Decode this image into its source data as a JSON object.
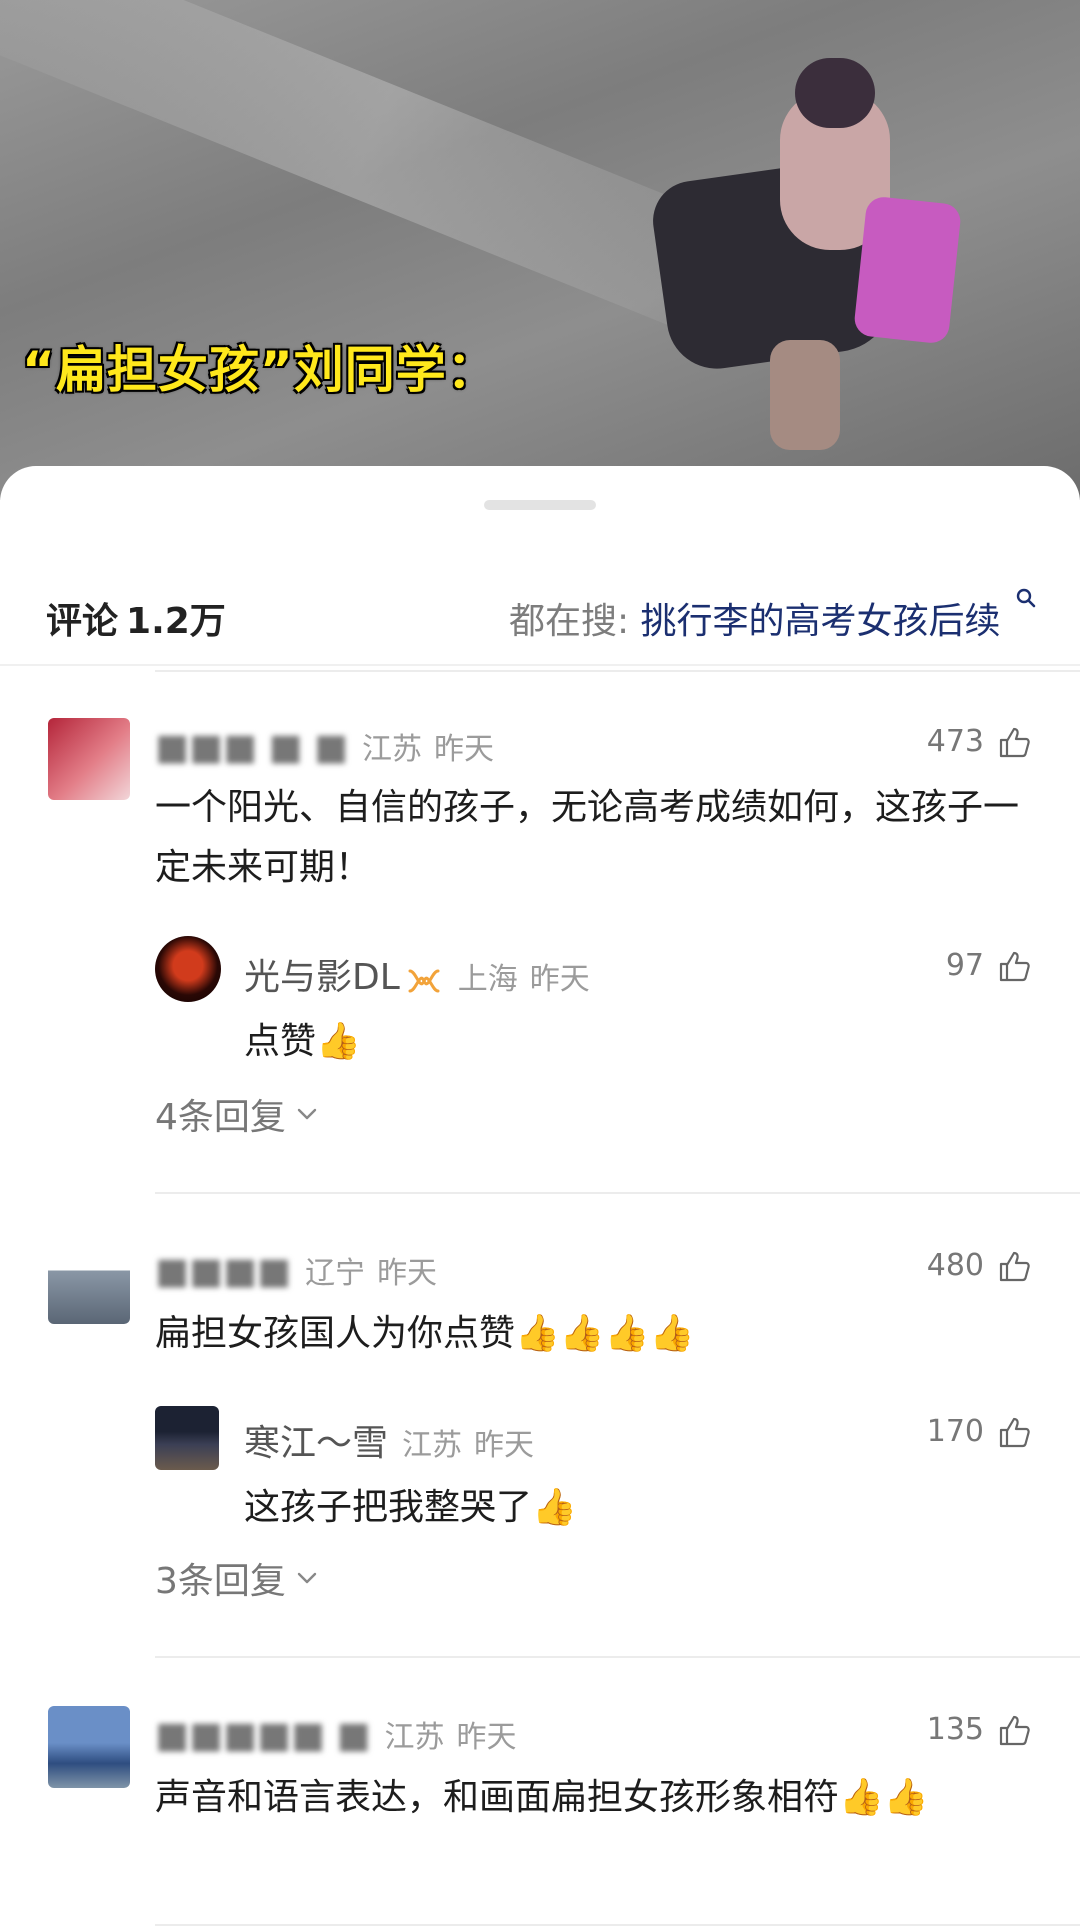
{
  "video": {
    "caption": "“扁担女孩”刘同学："
  },
  "header": {
    "comments_label": "评论",
    "comments_count": "1.2万",
    "search_prefix": "都在搜:",
    "search_keyword": "挑行李的高考女孩后续"
  },
  "comments": [
    {
      "name": "",
      "location": "江苏",
      "time": "昨天",
      "likes": "473",
      "text": "一个阳光、自信的孩子，无论高考成绩如何，这孩子一定未来可期！",
      "reply": {
        "name": "光与影DL",
        "location": "上海",
        "time": "昨天",
        "likes": "97",
        "text": "点赞👍"
      },
      "more_replies": "4条回复"
    },
    {
      "name": "",
      "location": "辽宁",
      "time": "昨天",
      "likes": "480",
      "text": "扁担女孩国人为你点赞👍👍👍👍",
      "reply": {
        "name": "寒江～雪",
        "location": "江苏",
        "time": "昨天",
        "likes": "170",
        "text": "这孩子把我整哭了👍"
      },
      "more_replies": "3条回复"
    },
    {
      "name": "",
      "location": "江苏",
      "time": "昨天",
      "likes": "135",
      "text": "声音和语言表达，和画面扁担女孩形象相符👍👍"
    }
  ],
  "colors": {
    "accent_keyword": "#1b2f70",
    "caption_yellow": "#ffe81c",
    "badge_orange": "#f2a33a"
  },
  "icons": [
    "search-icon",
    "thumbs-up-icon",
    "chevron-down-icon",
    "verified-badge-icon"
  ]
}
